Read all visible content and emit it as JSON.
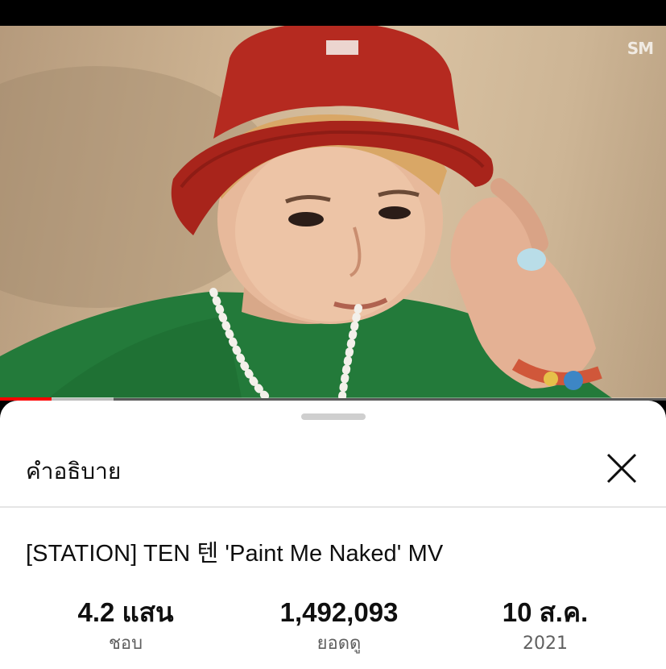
{
  "video": {
    "watermark": "SM",
    "progress_played": 0.077,
    "progress_buffered": 0.17
  },
  "sheet": {
    "title": "คำอธิบาย",
    "close_icon": "close-icon",
    "video_title": "[STATION] TEN 텐 'Paint Me Naked' MV",
    "stats": [
      {
        "value": "4.2 แสน",
        "label": "ชอบ"
      },
      {
        "value": "1,492,093",
        "label": "ยอดดู"
      },
      {
        "value": "10 ส.ค.",
        "label": "2021"
      }
    ]
  },
  "colors": {
    "progress_red": "#ff0000",
    "text_primary": "#0f0f0f",
    "text_secondary": "#606060"
  }
}
